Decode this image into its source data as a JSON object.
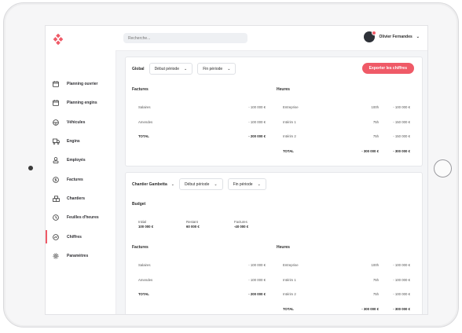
{
  "app": {
    "search_placeholder": "Recherche..."
  },
  "user": {
    "name": "Olivier Fernandes"
  },
  "sidebar": {
    "items": [
      {
        "label": "Planning ouvrier",
        "icon": "calendar-icon"
      },
      {
        "label": "Planning engins",
        "icon": "calendar-icon"
      },
      {
        "label": "Véhicules",
        "icon": "steering-wheel-icon"
      },
      {
        "label": "Engins",
        "icon": "truck-icon"
      },
      {
        "label": "Employés",
        "icon": "person-icon"
      },
      {
        "label": "Factures",
        "icon": "dollar-icon"
      },
      {
        "label": "Chantiers",
        "icon": "building-icon"
      },
      {
        "label": "Feuilles d'heures",
        "icon": "clock-icon"
      },
      {
        "label": "Chiffres",
        "icon": "chart-icon"
      },
      {
        "label": "Paramètres",
        "icon": "gear-icon"
      }
    ],
    "active": "Chiffres"
  },
  "global_card": {
    "filter_label": "Global",
    "start_label": "Début période",
    "end_label": "Fin période",
    "export_label": "Exporter les chiffres",
    "factures": {
      "title": "Factures",
      "rows": [
        {
          "label": "Salaires",
          "value": "- 100 000 €"
        },
        {
          "label": "Amendes",
          "value": "- 100 000 €"
        },
        {
          "label": "TOTAL",
          "value": "- 200 000 €"
        }
      ]
    },
    "heures": {
      "title": "Heures",
      "rows": [
        {
          "label": "Entreprise",
          "hours": "100h",
          "value": "- 100 000 €"
        },
        {
          "label": "Intérim 1",
          "hours": "75h",
          "value": "- 150 000 €"
        },
        {
          "label": "Intérim 2",
          "hours": "75h",
          "value": "- 150 000 €"
        },
        {
          "label": "TOTAL",
          "hours": "- 300 000 €",
          "value": "- 300 000 €"
        }
      ]
    }
  },
  "chantier_card": {
    "filter_label": "Chantier Gambetta",
    "start_label": "Début période",
    "end_label": "Fin période",
    "budget": {
      "title": "Budget",
      "items": [
        {
          "label": "Initial",
          "value": "100 000 €"
        },
        {
          "label": "Restant",
          "value": "60 000 €"
        },
        {
          "label": "Factures",
          "value": "-40 000 €"
        }
      ]
    },
    "factures": {
      "title": "Factures",
      "rows": [
        {
          "label": "Salaires",
          "value": "- 100 000 €"
        },
        {
          "label": "Amendes",
          "value": "- 100 000 €"
        },
        {
          "label": "TOTAL",
          "value": "- 200 000 €"
        }
      ]
    },
    "heures": {
      "title": "Heures",
      "rows": [
        {
          "label": "Entreprise",
          "hours": "100h",
          "value": "- 100 000 €"
        },
        {
          "label": "Intérim 1",
          "hours": "75h",
          "value": "- 100 000 €"
        },
        {
          "label": "Intérim 2",
          "hours": "75h",
          "value": "- 100 000 €"
        },
        {
          "label": "TOTAL",
          "hours": "- 300 000 €",
          "value": "- 300 000 €"
        }
      ]
    }
  },
  "colors": {
    "accent": "#ef5a67"
  }
}
